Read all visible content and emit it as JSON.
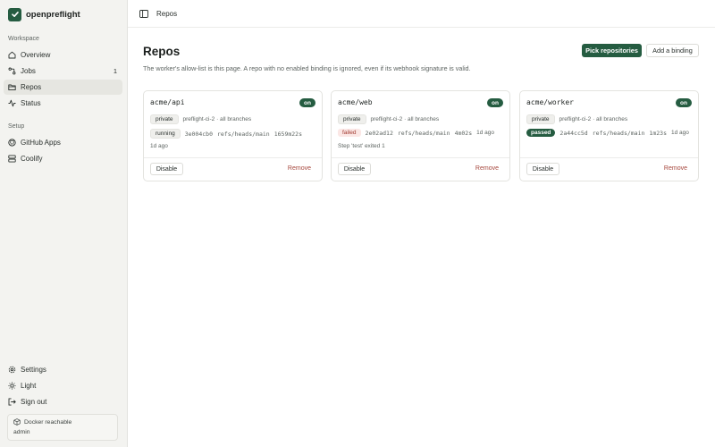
{
  "app": {
    "name": "openpreflight"
  },
  "sidebar": {
    "workspace_label": "Workspace",
    "workspace_items": [
      {
        "label": "Overview",
        "icon": "home-icon"
      },
      {
        "label": "Jobs",
        "icon": "link-icon",
        "count": "1"
      },
      {
        "label": "Repos",
        "icon": "folder-icon",
        "active": true
      },
      {
        "label": "Status",
        "icon": "activity-icon"
      }
    ],
    "setup_label": "Setup",
    "setup_items": [
      {
        "label": "GitHub Apps",
        "icon": "github-icon"
      },
      {
        "label": "Coolify",
        "icon": "server-icon"
      }
    ],
    "footer_items": [
      {
        "label": "Settings",
        "icon": "gear-icon"
      },
      {
        "label": "Light",
        "icon": "sun-icon"
      },
      {
        "label": "Sign out",
        "icon": "sign-out-icon"
      }
    ],
    "status": {
      "docker": "Docker reachable",
      "user": "admin"
    }
  },
  "header": {
    "breadcrumb": "Repos"
  },
  "main": {
    "title": "Repos",
    "subtitle": "The worker's allow-list is this page. A repo with no enabled binding is ignored, even if its webhook signature is valid.",
    "pick_button": "Pick repositories",
    "add_binding_button": "Add a binding",
    "cards": [
      {
        "name": "acme/api",
        "toggle": "on",
        "visibility": "private",
        "binding": "preflight-ci-2 · all branches",
        "status": "running",
        "commit": "3e004cb0",
        "ref": "refs/heads/main",
        "duration": "1659m22s",
        "age": "1d ago",
        "message": "",
        "disable": "Disable",
        "remove": "Remove"
      },
      {
        "name": "acme/web",
        "toggle": "on",
        "visibility": "private",
        "binding": "preflight-ci-2 · all branches",
        "status": "failed",
        "commit": "2e02ad12",
        "ref": "refs/heads/main",
        "duration": "4m02s",
        "age": "1d ago",
        "message": "Step 'test' exited 1",
        "disable": "Disable",
        "remove": "Remove"
      },
      {
        "name": "acme/worker",
        "toggle": "on",
        "visibility": "private",
        "binding": "preflight-ci-2 · all branches",
        "status": "passed",
        "commit": "2a44cc5d",
        "ref": "refs/heads/main",
        "duration": "1m23s",
        "age": "1d ago",
        "message": "",
        "disable": "Disable",
        "remove": "Remove"
      }
    ]
  }
}
